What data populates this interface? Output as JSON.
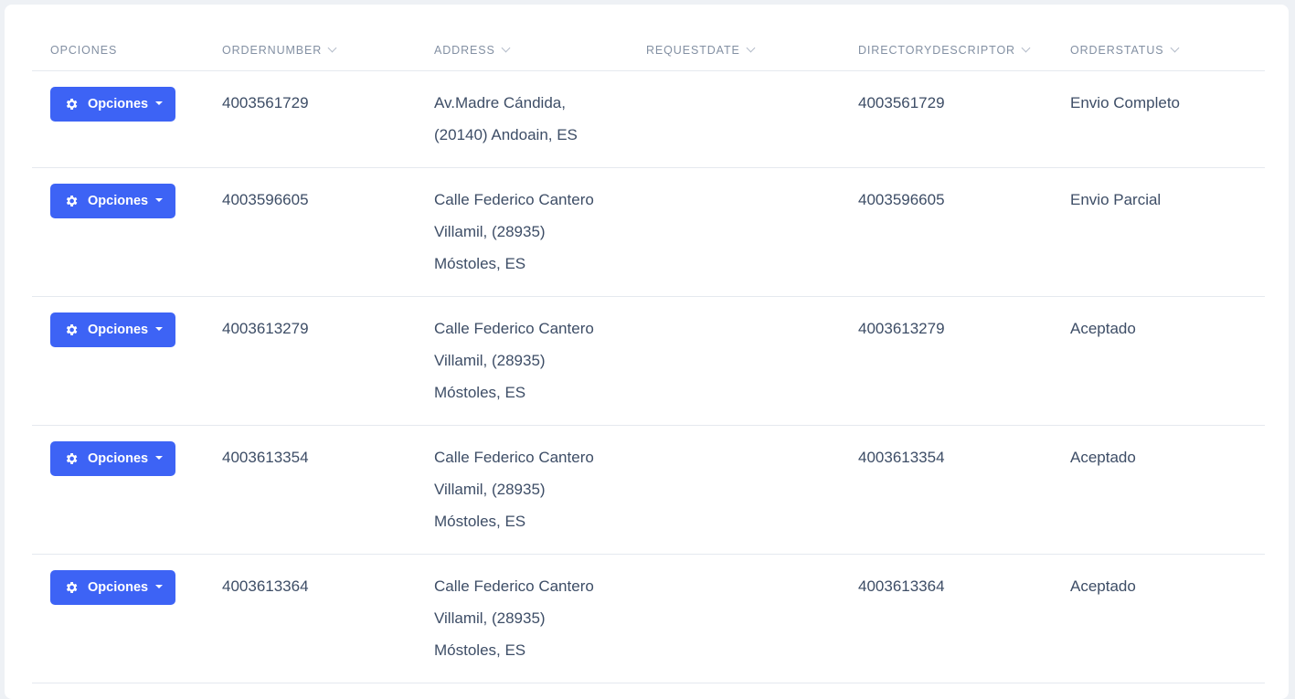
{
  "columns": [
    {
      "label": "OPCIONES",
      "sortable": false
    },
    {
      "label": "ORDERNUMBER",
      "sortable": true
    },
    {
      "label": "ADDRESS",
      "sortable": true
    },
    {
      "label": "REQUESTDATE",
      "sortable": true
    },
    {
      "label": "DIRECTORYDESCRIPTOR",
      "sortable": true
    },
    {
      "label": "ORDERSTATUS",
      "sortable": true
    }
  ],
  "button": {
    "label": "Opciones",
    "icon": "gear-icon",
    "color": "#3d63f5"
  },
  "rows": [
    {
      "order_number": "4003561729",
      "address_lines": [
        "Av.Madre Cándida,",
        "(20140) Andoain, ES"
      ],
      "request_date": "",
      "directory_descriptor": "4003561729",
      "order_status": "Envio Completo"
    },
    {
      "order_number": "4003596605",
      "address_lines": [
        "Calle Federico Cantero",
        "Villamil, (28935)",
        "Móstoles, ES"
      ],
      "request_date": "",
      "directory_descriptor": "4003596605",
      "order_status": "Envio Parcial"
    },
    {
      "order_number": "4003613279",
      "address_lines": [
        "Calle Federico Cantero",
        "Villamil, (28935)",
        "Móstoles, ES"
      ],
      "request_date": "",
      "directory_descriptor": "4003613279",
      "order_status": "Aceptado"
    },
    {
      "order_number": "4003613354",
      "address_lines": [
        "Calle Federico Cantero",
        "Villamil, (28935)",
        "Móstoles, ES"
      ],
      "request_date": "",
      "directory_descriptor": "4003613354",
      "order_status": "Aceptado"
    },
    {
      "order_number": "4003613364",
      "address_lines": [
        "Calle Federico Cantero",
        "Villamil, (28935)",
        "Móstoles, ES"
      ],
      "request_date": "",
      "directory_descriptor": "4003613364",
      "order_status": "Aceptado"
    }
  ]
}
